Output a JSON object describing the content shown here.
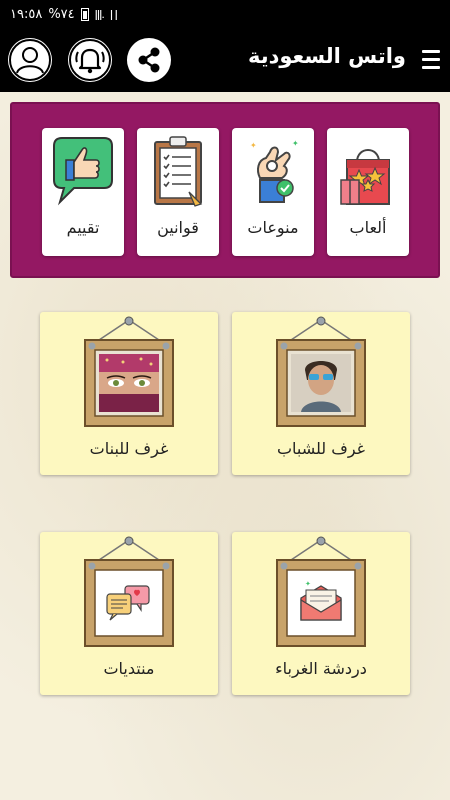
{
  "status_bar": {
    "time": "١٩:٥٨",
    "battery": "%٧٤"
  },
  "header": {
    "title": "واتس السعودية",
    "menu_icon": "hamburger-menu-icon",
    "buttons": [
      "share-icon",
      "bell-icon",
      "profile-icon"
    ]
  },
  "top_panel": {
    "color": "#941863",
    "items": [
      {
        "label": "ألعاب",
        "icon": "shopping-bag-stars-icon"
      },
      {
        "label": "منوعات",
        "icon": "ok-hand-icon"
      },
      {
        "label": "قوانين",
        "icon": "clipboard-checklist-icon"
      },
      {
        "label": "تقييم",
        "icon": "thumbs-up-icon"
      }
    ]
  },
  "rooms": [
    {
      "label": "غرف للشباب",
      "icon": "young-man-photo"
    },
    {
      "label": "غرف للبنات",
      "icon": "woman-eyes-photo"
    },
    {
      "label": "دردشة الغرباء",
      "icon": "envelope-icon"
    },
    {
      "label": "منتديات",
      "icon": "chat-bubbles-icon"
    }
  ]
}
